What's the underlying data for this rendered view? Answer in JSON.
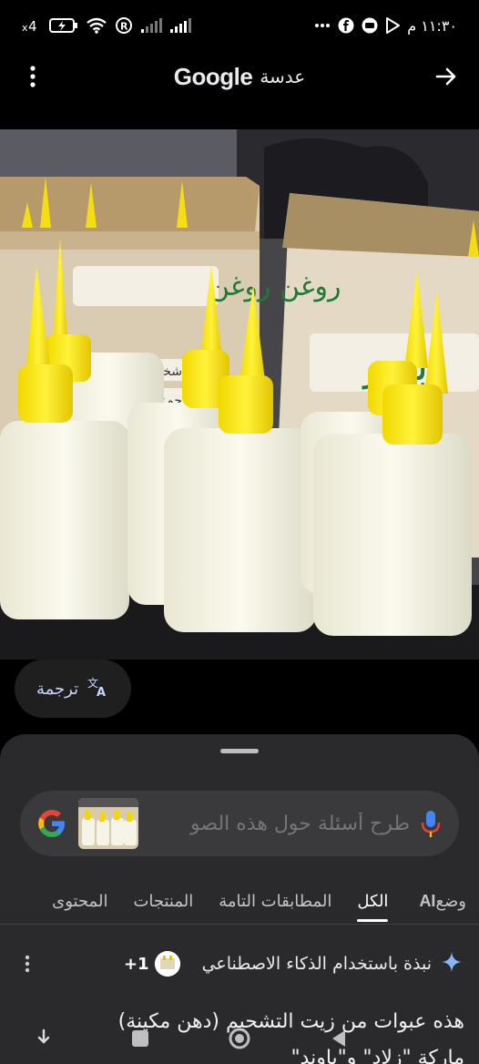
{
  "status_bar": {
    "time": "١١:٣٠ م",
    "battery_label": "4"
  },
  "header": {
    "brand": "Google",
    "brand_sub": "عدسة"
  },
  "translate": {
    "label": "ترجمة"
  },
  "search": {
    "placeholder": "طرح أسئلة حول هذه الصو"
  },
  "tabs": [
    {
      "label": "وضع AI",
      "ai_word": "AI",
      "prefix": "وضع"
    },
    {
      "label": "الكل"
    },
    {
      "label": "المطابقات التامة"
    },
    {
      "label": "المنتجات"
    },
    {
      "label": "المحتوى"
    }
  ],
  "ai_overview": {
    "title": "نبذة باستخدام الذكاء الاصطناعي",
    "source_count": "1+",
    "text_line1": "هذه عبوات من زيت التشحيم (دهن مكينة)",
    "text_line2": "ماركة \"زلاد\" و\"باوند\""
  },
  "photo_labels": {
    "label_left": "روغن روغن",
    "label_spec": "شخصات:اند",
    "label_volume": "حم:٨٠",
    "label_right": "بلور"
  }
}
